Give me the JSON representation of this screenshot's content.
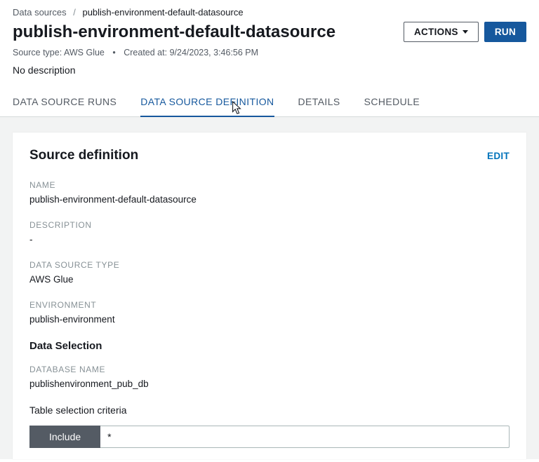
{
  "breadcrumb": {
    "root": "Data sources",
    "current": "publish-environment-default-datasource"
  },
  "page": {
    "title": "publish-environment-default-datasource",
    "actions_label": "ACTIONS",
    "run_label": "RUN",
    "source_type_label": "Source type:",
    "source_type_value": "AWS Glue",
    "created_at_label": "Created at:",
    "created_at_value": "9/24/2023, 3:46:56 PM",
    "no_description": "No description"
  },
  "tabs": {
    "runs": "DATA SOURCE RUNS",
    "definition": "DATA SOURCE DEFINITION",
    "details": "DETAILS",
    "schedule": "SCHEDULE"
  },
  "panel": {
    "title": "Source definition",
    "edit": "EDIT",
    "fields": {
      "name_label": "NAME",
      "name_value": "publish-environment-default-datasource",
      "description_label": "DESCRIPTION",
      "description_value": "-",
      "type_label": "DATA SOURCE TYPE",
      "type_value": "AWS Glue",
      "env_label": "ENVIRONMENT",
      "env_value": "publish-environment"
    },
    "data_selection_heading": "Data Selection",
    "database_name_label": "DATABASE NAME",
    "database_name_value": "publishenvironment_pub_db",
    "criteria_heading": "Table selection criteria",
    "criteria_mode": "Include",
    "criteria_value": "*"
  }
}
